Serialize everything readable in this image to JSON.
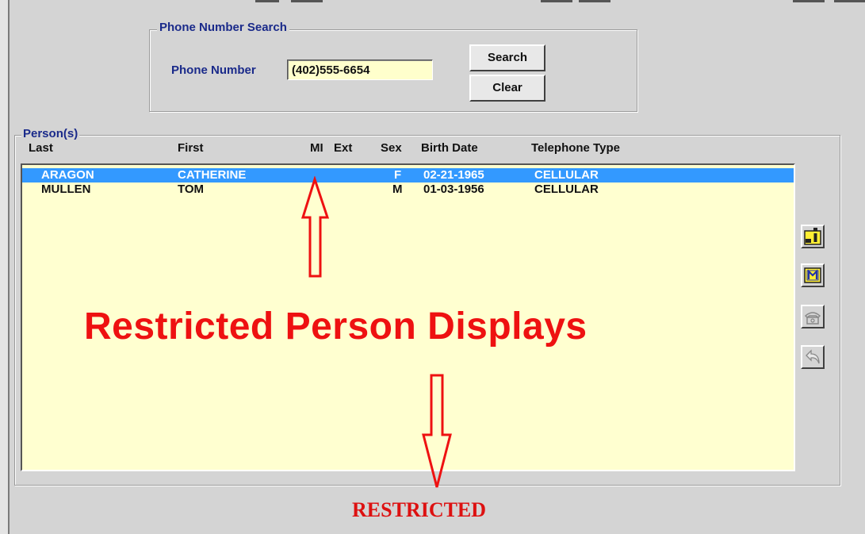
{
  "search_group": {
    "legend": "Phone Number Search",
    "phone_label": "Phone Number",
    "phone_value": "(402)555-6654",
    "search_button": "Search",
    "clear_button": "Clear"
  },
  "persons_group": {
    "legend": "Person(s)",
    "columns": {
      "last": "Last",
      "first": "First",
      "mi": "MI",
      "ext": "Ext",
      "sex": "Sex",
      "birth_date": "Birth Date",
      "telephone_type": "Telephone Type"
    },
    "rows": [
      {
        "last": "ARAGON",
        "first": "CATHERINE",
        "mi": "",
        "ext": "",
        "sex": "F",
        "birth_date": "02-21-1965",
        "telephone_type": "CELLULAR",
        "selected": true
      },
      {
        "last": "MULLEN",
        "first": "TOM",
        "mi": "",
        "ext": "",
        "sex": "M",
        "birth_date": "01-03-1956",
        "telephone_type": "CELLULAR",
        "selected": false
      }
    ]
  },
  "side_toolbar": {
    "icons": [
      "person-info-icon",
      "m-icon",
      "telephone-icon",
      "back-arrow-icon"
    ]
  },
  "annotations": {
    "main_text": "Restricted Person Displays",
    "footer_text": "RESTRICTED",
    "color": "#ee1111"
  },
  "colors": {
    "selection": "#3399ff",
    "list_background": "#ffffd0",
    "label_blue": "#1a2a8a"
  }
}
